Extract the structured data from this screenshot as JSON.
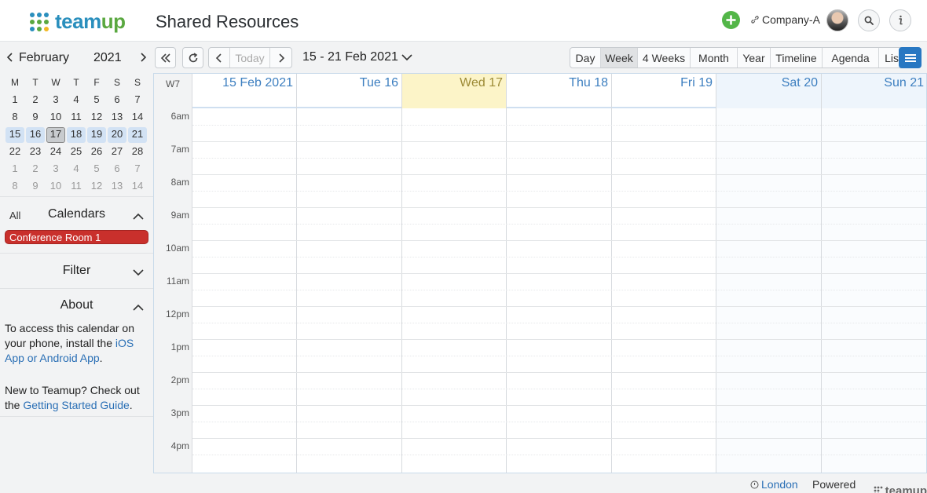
{
  "header": {
    "logo_text_a": "team",
    "logo_text_b": "up",
    "title": "Shared Resources",
    "company": "Company-A",
    "colors": {
      "brand_blue": "#2a8fbd",
      "brand_green": "#5aa840",
      "add_green": "#53b648"
    }
  },
  "mini_calendar": {
    "month": "February",
    "year": "2021",
    "weekdays": [
      "M",
      "T",
      "W",
      "T",
      "F",
      "S",
      "S"
    ],
    "weeks": [
      [
        {
          "d": "1"
        },
        {
          "d": "2"
        },
        {
          "d": "3"
        },
        {
          "d": "4"
        },
        {
          "d": "5"
        },
        {
          "d": "6"
        },
        {
          "d": "7"
        }
      ],
      [
        {
          "d": "8"
        },
        {
          "d": "9"
        },
        {
          "d": "10"
        },
        {
          "d": "11"
        },
        {
          "d": "12"
        },
        {
          "d": "13"
        },
        {
          "d": "14"
        }
      ],
      [
        {
          "d": "15",
          "s": "week"
        },
        {
          "d": "16",
          "s": "week"
        },
        {
          "d": "17",
          "s": "today"
        },
        {
          "d": "18",
          "s": "week"
        },
        {
          "d": "19",
          "s": "week"
        },
        {
          "d": "20",
          "s": "week"
        },
        {
          "d": "21",
          "s": "week"
        }
      ],
      [
        {
          "d": "22"
        },
        {
          "d": "23"
        },
        {
          "d": "24"
        },
        {
          "d": "25"
        },
        {
          "d": "26"
        },
        {
          "d": "27"
        },
        {
          "d": "28"
        }
      ],
      [
        {
          "d": "1",
          "s": "other"
        },
        {
          "d": "2",
          "s": "other"
        },
        {
          "d": "3",
          "s": "other"
        },
        {
          "d": "4",
          "s": "other"
        },
        {
          "d": "5",
          "s": "other"
        },
        {
          "d": "6",
          "s": "other"
        },
        {
          "d": "7",
          "s": "other"
        }
      ],
      [
        {
          "d": "8",
          "s": "other"
        },
        {
          "d": "9",
          "s": "other"
        },
        {
          "d": "10",
          "s": "other"
        },
        {
          "d": "11",
          "s": "other"
        },
        {
          "d": "12",
          "s": "other"
        },
        {
          "d": "13",
          "s": "other"
        },
        {
          "d": "14",
          "s": "other"
        }
      ]
    ]
  },
  "sidebar": {
    "all_label": "All",
    "calendars_label": "Calendars",
    "calendar_item": "Conference Room 1",
    "calendar_color": "#c9302c",
    "filter_label": "Filter",
    "about_label": "About",
    "about_p1_a": "To access this calendar on your phone, install the ",
    "about_p1_link": "iOS App or Android App",
    "about_p1_b": ".",
    "about_p2_a": "New to Teamup? Check out the ",
    "about_p2_link": "Getting Started Guide",
    "about_p2_b": "."
  },
  "toolbar": {
    "today": "Today",
    "date_range": "15 - 21 Feb 2021",
    "views": [
      "Day",
      "Week",
      "4 Weeks",
      "Month",
      "Year",
      "Timeline",
      "Agenda",
      "List"
    ],
    "active_view": "Week"
  },
  "grid": {
    "week_label": "W7",
    "days": [
      {
        "label": "15 Feb 2021",
        "type": "normal"
      },
      {
        "label": "Tue 16",
        "type": "normal"
      },
      {
        "label": "Wed 17",
        "type": "today"
      },
      {
        "label": "Thu 18",
        "type": "normal"
      },
      {
        "label": "Fri 19",
        "type": "normal"
      },
      {
        "label": "Sat 20",
        "type": "weekend"
      },
      {
        "label": "Sun 21",
        "type": "weekend"
      }
    ],
    "hours": [
      "6am",
      "7am",
      "8am",
      "9am",
      "10am",
      "11am",
      "12pm",
      "1pm",
      "2pm",
      "3pm",
      "4pm"
    ]
  },
  "footer": {
    "timezone": "London",
    "powered_by": "Powered by",
    "brand": "teamup"
  }
}
